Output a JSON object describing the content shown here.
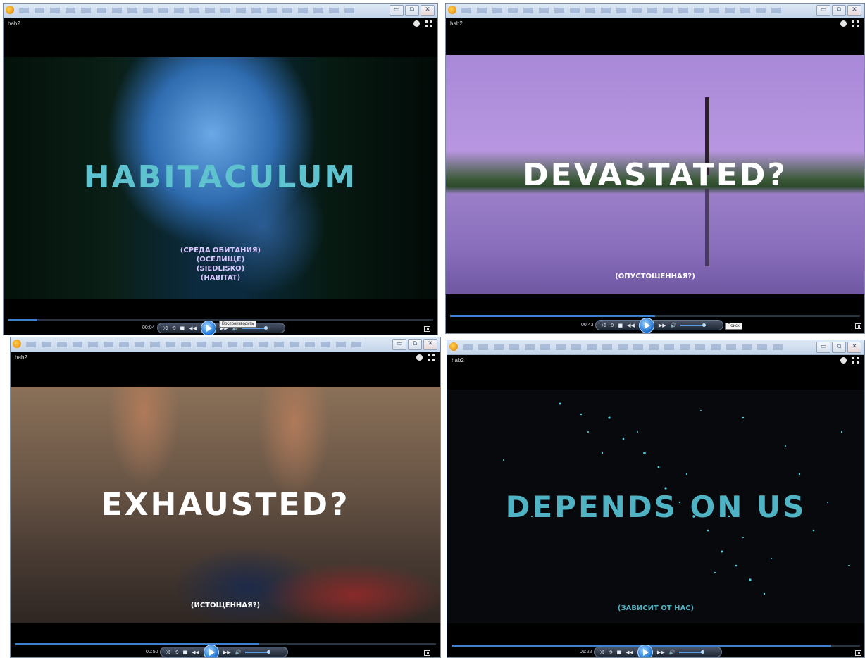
{
  "windows": [
    {
      "filename": "hab2",
      "title": "HABITACULUM",
      "subtitles": [
        "(СРЕДА ОБИТАНИЯ)",
        "(ОСЕЛИЩЕ)",
        "(SIEDLISKO)",
        "(HABITAT)"
      ],
      "time": "00:04",
      "tooltip": "Воспроизводить",
      "progress": 0.07,
      "title_color": "#5fc3cf",
      "subtitle_color": "#d8c6ff"
    },
    {
      "filename": "hab2",
      "title": "DEVASTATED?",
      "subtitles": [
        "(ОПУСТОШЕННАЯ?)"
      ],
      "time": "00:43",
      "tooltip": "Поиск",
      "progress": 0.5,
      "title_color": "#ffffff",
      "subtitle_color": "#ffffff"
    },
    {
      "filename": "hab2",
      "title": "EXHAUSTED?",
      "subtitles": [
        "(ИСТОЩЕННАЯ?)"
      ],
      "time": "00:50",
      "tooltip": "",
      "progress": 0.58,
      "title_color": "#ffffff",
      "subtitle_color": "#ffffff"
    },
    {
      "filename": "hab2",
      "title": "DEPENDS ON US",
      "subtitles": [
        "(ЗАВИСИТ ОТ НАС)"
      ],
      "time": "01:22",
      "tooltip": "",
      "progress": 0.93,
      "title_color": "#4fb3c4",
      "subtitle_color": "#4fb3c4"
    }
  ],
  "controls": {
    "shuffle": "⤮",
    "repeat": "⟲",
    "stop": "■",
    "prev": "◀◀",
    "next": "▶▶",
    "volume": "🔊"
  },
  "window_buttons": {
    "minimize": "▭",
    "maximize": "⧉",
    "close": "✕"
  }
}
